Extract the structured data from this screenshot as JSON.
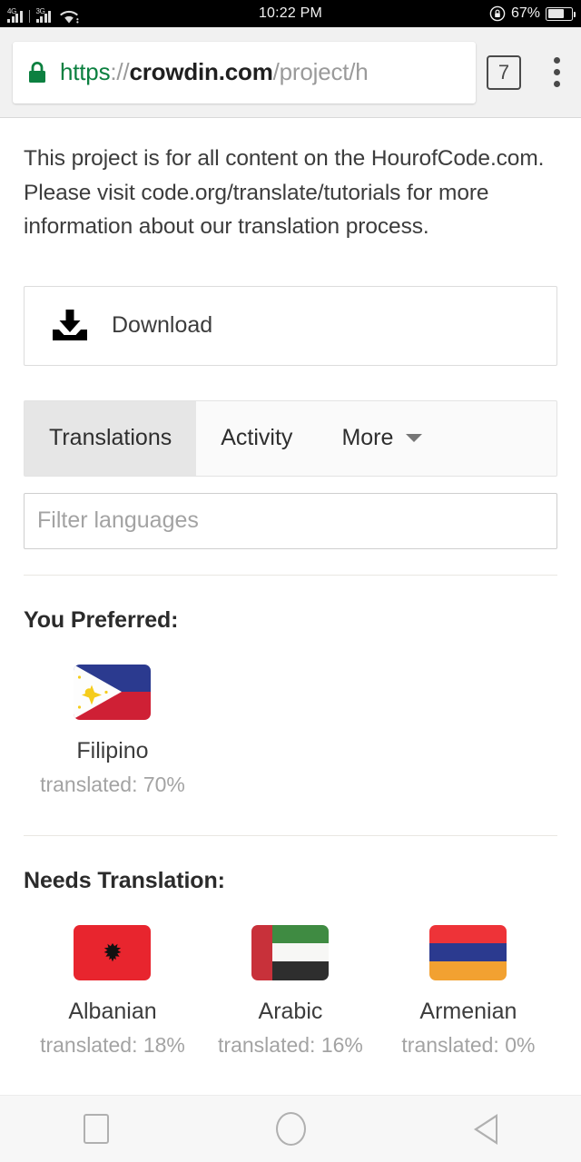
{
  "statusbar": {
    "signal_1_label": "4G",
    "signal_2_label": "3G",
    "wifi_icon": "wifi-icon",
    "time": "10:22 PM",
    "rotation_lock_icon": "rotation-lock-icon",
    "battery_percent": "67%",
    "battery_level": 67
  },
  "browser": {
    "lock_icon": "lock-icon",
    "url": {
      "scheme": "https",
      "separator": "://",
      "host": "crowdin.com",
      "path": "/project/h"
    },
    "tab_count": "7",
    "menu_icon": "kebab-menu-icon"
  },
  "content": {
    "description_lines": [
      "This project is for all content on the HourofCode.com.",
      "Please visit code.org/translate/tutorials for more",
      "information about our translation process."
    ],
    "download": {
      "icon": "download-icon",
      "label": "Download"
    },
    "tabs": [
      {
        "label": "Translations",
        "active": true
      },
      {
        "label": "Activity",
        "active": false
      },
      {
        "label": "More",
        "active": false,
        "caret_icon": "chevron-down-icon"
      }
    ],
    "filter": {
      "placeholder": "Filter languages",
      "value": ""
    },
    "preferred": {
      "title": "You Preferred:",
      "languages": [
        {
          "name": "Filipino",
          "progress": "translated: 70%",
          "percent": 70,
          "flag": "philippines-flag"
        }
      ]
    },
    "needs_translation": {
      "title": "Needs Translation:",
      "languages": [
        {
          "name": "Albanian",
          "progress": "translated: 18%",
          "percent": 18,
          "flag": "albania-flag"
        },
        {
          "name": "Arabic",
          "progress": "translated: 16%",
          "percent": 16,
          "flag": "uae-flag"
        },
        {
          "name": "Armenian",
          "progress": "translated: 0%",
          "percent": 0,
          "flag": "armenia-flag"
        }
      ]
    }
  },
  "navbar": {
    "recents_icon": "square-recents-icon",
    "home_icon": "circle-home-icon",
    "back_icon": "triangle-back-icon"
  },
  "colors": {
    "status_bar_bg": "#000000",
    "chrome_bg": "#f1f1f1",
    "https_green": "#0c8040",
    "active_tab_bg": "#e6e6e6",
    "muted_text": "#a3a3a3"
  }
}
